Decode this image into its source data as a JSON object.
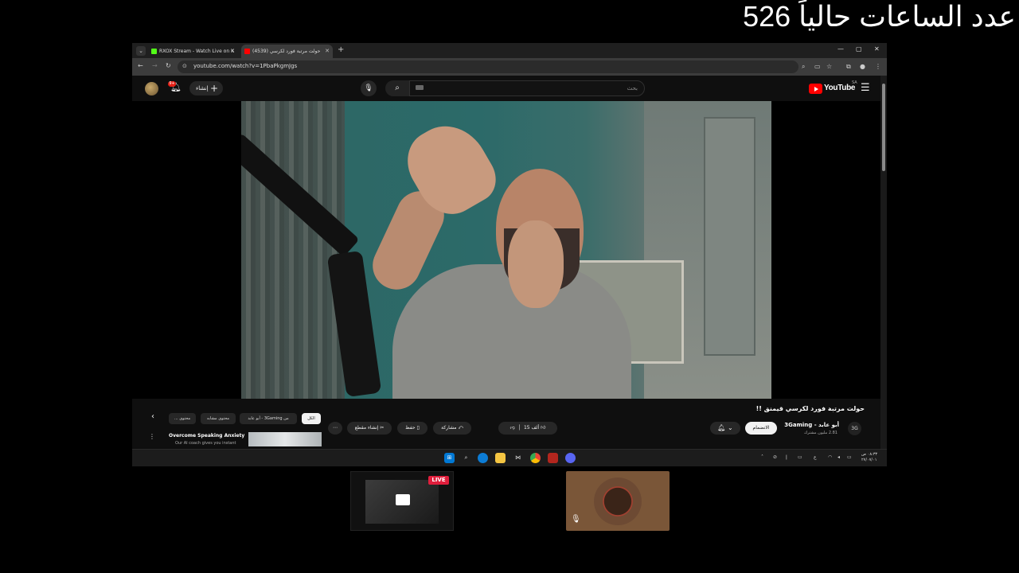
{
  "overlay": {
    "hours_text": "عدد الساعات حالياً 526"
  },
  "browser": {
    "tabs": [
      {
        "label": "RXOX Stream - Watch Live on K",
        "favicon_color": "#53fc18"
      },
      {
        "label": "(4539) حولت مرتبة فورد لكرسي",
        "favicon_color": "#ff0000"
      }
    ],
    "tab_dropdown": "⌄",
    "new_tab": "+",
    "window_controls": {
      "minimize": "—",
      "maximize": "▢",
      "close": "✕"
    },
    "url": "youtube.com/watch?v=1PbaPkgmJgs",
    "nav": {
      "back": "←",
      "forward": "→",
      "reload": "↻",
      "site_info": "⊙"
    },
    "toolbar_icons": [
      "zoom-icon",
      "cast-icon",
      "star-icon",
      "extension-icon",
      "profile-icon",
      "menu-icon"
    ]
  },
  "youtube": {
    "create_label": "إنشاء",
    "notif_count": "9+",
    "search_placeholder": "بحث",
    "logo_text": "YouTube",
    "logo_region": "SA",
    "video": {
      "title": "حولت مرتبة فورد لكرسي قيمنق !!",
      "channel": "أبو عابد - 3Gaming",
      "subscribers": "2.81 مليون مشترك",
      "join_label": "الانضمام",
      "likes": "15 ألف",
      "share_label": "مشاركة",
      "save_label": "حفظ",
      "clip_label": "إنشاء مقطع",
      "channel_logo": "3G"
    },
    "chips": [
      "الكل",
      "من 3Gaming - أبو عابد",
      "محتوى مشابه",
      "محتوى ..."
    ],
    "ad": {
      "title": "Overcome Speaking Anxiety",
      "subtitle": "Our AI coach gives you instant"
    }
  },
  "taskbar": {
    "clock_time": "٠٨:٣٣ ص",
    "clock_date": "٢٧/٠٧/٠١",
    "lang": "ع"
  },
  "stream_thumbs": {
    "live_label": "LIVE"
  }
}
